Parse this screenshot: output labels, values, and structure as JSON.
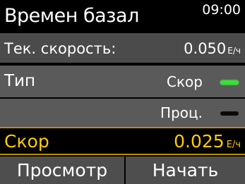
{
  "header": {
    "title": "Времен базал",
    "time": "09:00"
  },
  "current_rate": {
    "label": "Тек. скорость:",
    "value": "0.050",
    "unit": "Е/ч"
  },
  "type": {
    "label": "Тип",
    "options": [
      {
        "label": "Скор",
        "selected": true,
        "indicator_color": "#2ee82e"
      },
      {
        "label": "Проц.",
        "selected": false,
        "indicator_color": "#0a0a0a"
      }
    ]
  },
  "speed": {
    "label": "Скор",
    "value": "0.025",
    "unit": "Е/ч",
    "color": "#ffcc00"
  },
  "softkeys": {
    "left": "Просмотр",
    "right": "Начать"
  }
}
